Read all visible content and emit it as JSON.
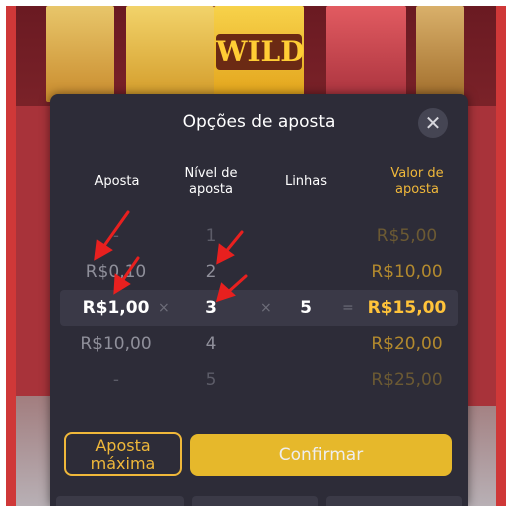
{
  "background": {
    "reel_symbol": "WILD"
  },
  "modal": {
    "title": "Opções de aposta",
    "close_icon": "close-icon"
  },
  "columns": {
    "aposta": "Aposta",
    "nivel": "Nível de aposta",
    "linhas": "Linhas",
    "valor": "Valor de aposta"
  },
  "rows": [
    {
      "aposta": "-",
      "nivel": "1",
      "valor": "R$5,00"
    },
    {
      "aposta": "R$0,10",
      "nivel": "2",
      "valor": "R$10,00"
    },
    {
      "aposta": "R$1,00",
      "nivel": "3",
      "linhas": "5",
      "valor": "R$15,00"
    },
    {
      "aposta": "R$10,00",
      "nivel": "4",
      "valor": "R$20,00"
    },
    {
      "aposta": "-",
      "nivel": "5",
      "valor": "R$25,00"
    }
  ],
  "operators": {
    "times": "×",
    "equals": "="
  },
  "buttons": {
    "max_bet": "Aposta máxima",
    "confirm": "Confirmar"
  },
  "colors": {
    "accent": "#f6c42a",
    "gold_text": "#ffc33a",
    "modal_bg": "#2d2c38",
    "annotation_arrow": "#e8201f"
  }
}
